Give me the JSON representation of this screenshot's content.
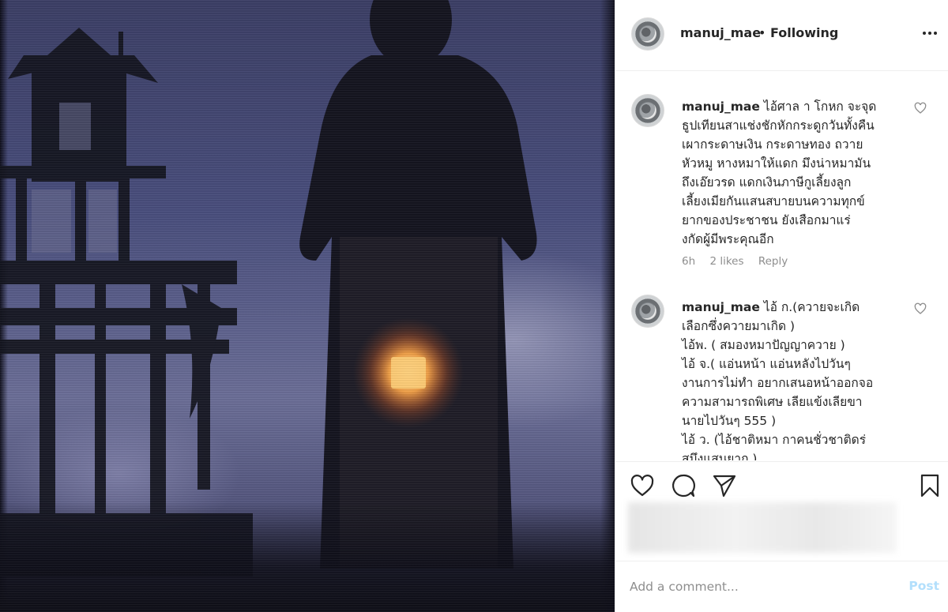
{
  "colors": {
    "text": "#262626",
    "meta": "#8e8e8e",
    "post_disabled": "#b2dffc",
    "divider": "#efefef"
  },
  "post_image": {
    "alt_icon": "photo-scene"
  },
  "header": {
    "username": "manuj_mae",
    "separator": "•",
    "follow_status": "Following",
    "more_icon": "more-horizontal-icon"
  },
  "comments": [
    {
      "username": "manuj_mae",
      "text": " ไอ้ศาล า โกหก จะจุด\nธูปเทียนสาแช่งชักหักกระดูกวันทั้งคืน\nเผากระดาษเงิน กระดาษทอง ถวาย\nหัวหมู หางหมาให้แดก มึงน่าหมามัน\nถึงเอ๊ยวรด แดกเงินภาษีกูเลี้ยงลูก\nเลี้ยงเมียกันแสนสบายบนความทุกข์\nยากของประชาชน ยังเสือกมาแร่\nงกัดผู้มีพระคุณอีก",
      "time": "6h",
      "likes": "2 likes",
      "reply": "Reply"
    },
    {
      "username": "manuj_mae",
      "text": " ไอ้ ก.(ควายจะเกิด\nเลือกซึ่งควายมาเกิด )\nไอ้พ. ( สมองหมาปัญญาควาย )\nไอ้ จ.( แอ่นหน้า แอ่นหลังไปวันๆ\nงานการไม่ทำ อยากเสนอหน้าออกจอ\nความสามารถพิเศษ เลียแข้งเลียขา\nนายไปวันๆ 555 )\nไอ้ ว. (ไอ้ชาติหมา กาคนชั่วชาติดร่\nสมึงแสนยาก )"
    }
  ],
  "actions": {
    "like_icon": "heart-icon",
    "comment_icon": "comment-icon",
    "share_icon": "send-icon",
    "save_icon": "bookmark-icon"
  },
  "add_comment": {
    "placeholder": "Add a comment...",
    "post_label": "Post"
  }
}
